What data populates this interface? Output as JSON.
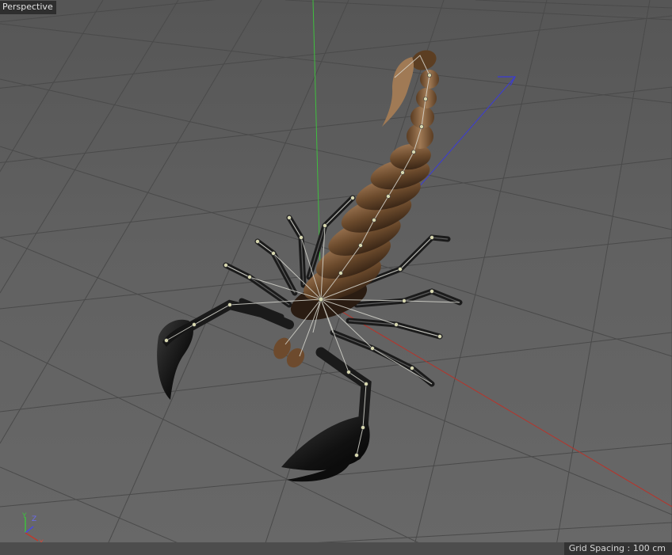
{
  "viewport": {
    "camera_label": "Perspective",
    "grid_spacing_text": "Grid Spacing : 100 cm"
  },
  "axes": {
    "x_color": "#c0392b",
    "y_color": "#3fbf3f",
    "z_color": "#3b3bd6"
  },
  "gizmo": {
    "x_label": "X",
    "y_label": "Y",
    "z_label": "Z"
  },
  "model": {
    "name_icon": "scorpion-model",
    "body_color": "#6b4a2c",
    "claw_color": "#1c1c1c",
    "joint_color": "#d8d8b0"
  }
}
